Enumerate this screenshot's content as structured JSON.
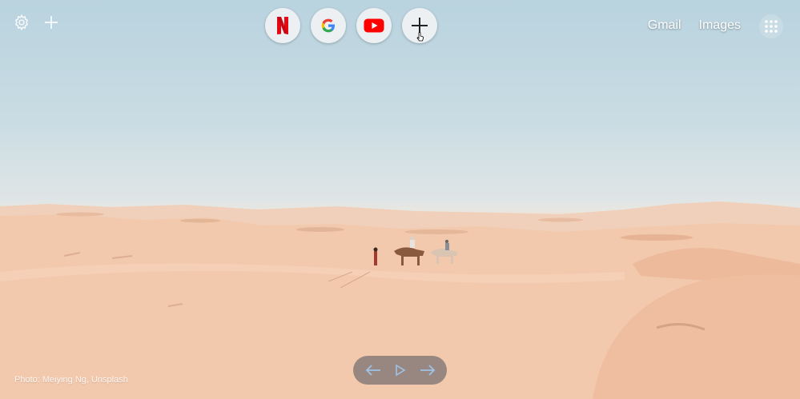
{
  "top_left": {
    "settings_icon": "gear-icon",
    "add_icon": "plus-icon"
  },
  "shortcuts": [
    {
      "name": "Netflix",
      "icon": "netflix-icon",
      "color": "#e50914"
    },
    {
      "name": "Google",
      "icon": "google-icon",
      "color": "#4285f4"
    },
    {
      "name": "YouTube",
      "icon": "youtube-icon",
      "color": "#ff0000"
    },
    {
      "name": "Add shortcut",
      "icon": "plus-icon",
      "color": "#222222"
    }
  ],
  "top_right": {
    "links": [
      "Gmail",
      "Images"
    ],
    "apps_icon": "apps-grid-icon"
  },
  "photo_credit": "Photo: Meiying Ng, Unsplash",
  "media_bar": {
    "prev_icon": "arrow-left-icon",
    "play_icon": "play-icon",
    "next_icon": "arrow-right-icon",
    "color": "#9ec3e6"
  }
}
